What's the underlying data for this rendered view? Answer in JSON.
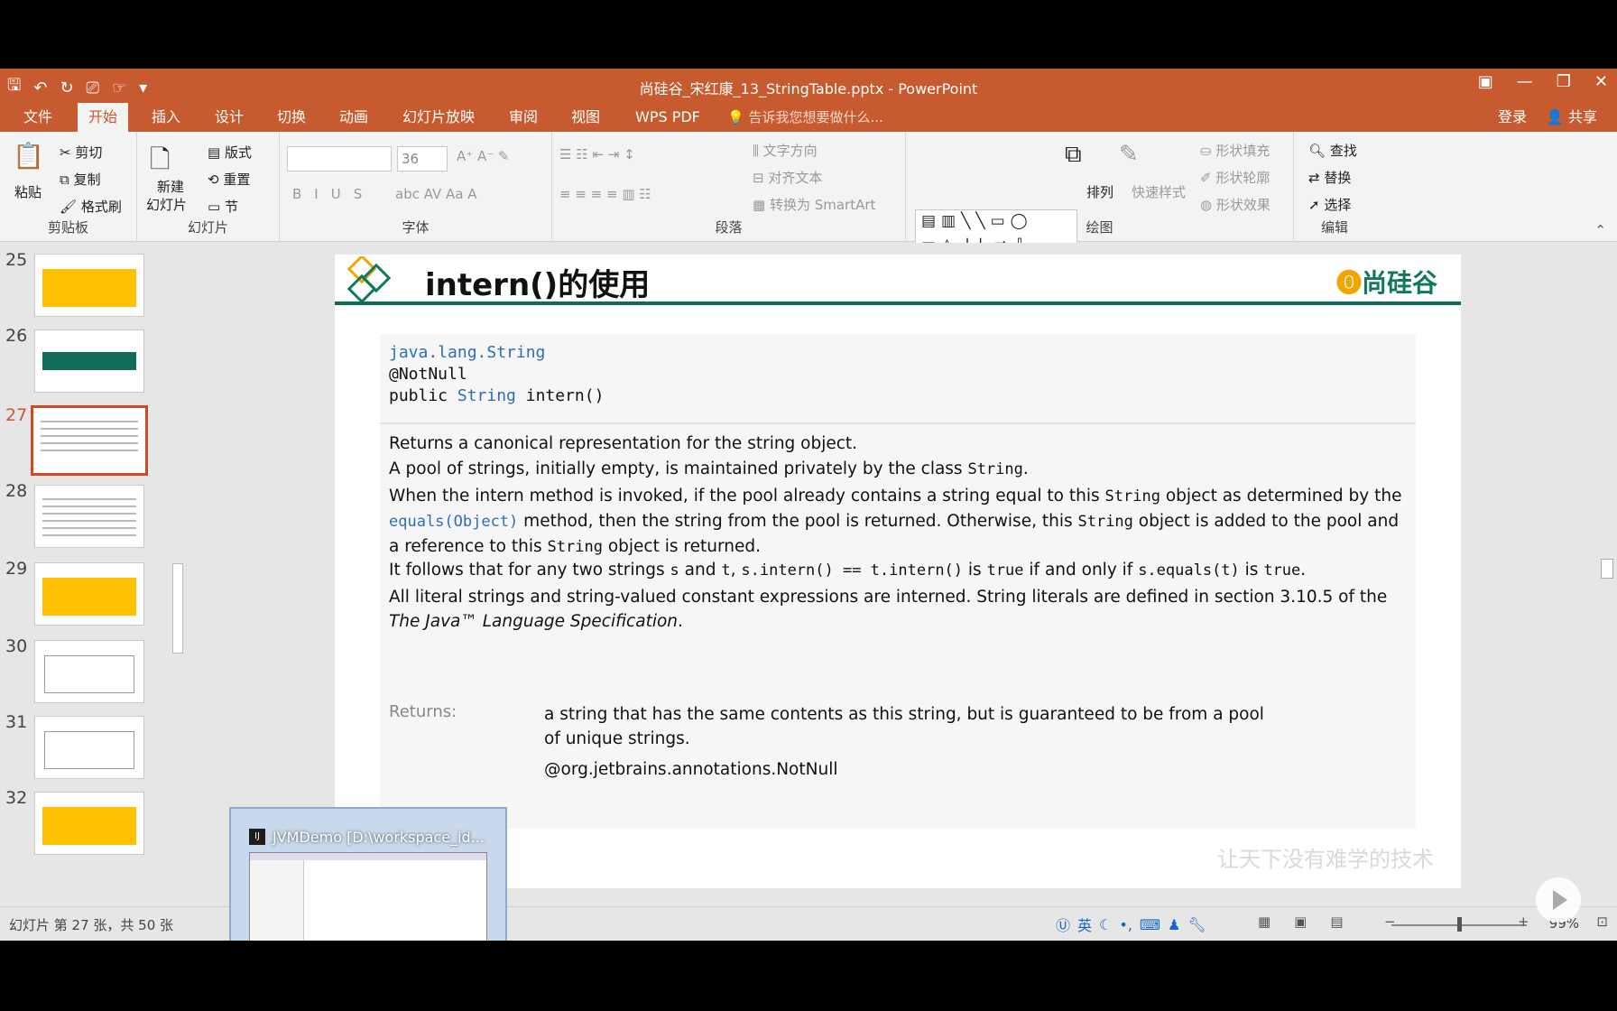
{
  "titlebar": {
    "doc_title": "尚硅谷_宋红康_13_StringTable.pptx - PowerPoint"
  },
  "tabs": [
    {
      "label": "文件"
    },
    {
      "label": "开始"
    },
    {
      "label": "插入"
    },
    {
      "label": "设计"
    },
    {
      "label": "切换"
    },
    {
      "label": "动画"
    },
    {
      "label": "幻灯片放映"
    },
    {
      "label": "审阅"
    },
    {
      "label": "视图"
    },
    {
      "label": "WPS PDF"
    }
  ],
  "tellme": "告诉我您想要做什么...",
  "login": "登录",
  "share": "共享",
  "ribbon": {
    "clipboard": {
      "paste": "粘贴",
      "cut": "剪切",
      "copy": "复制",
      "format_painter": "格式刷",
      "label": "剪贴板"
    },
    "slides": {
      "new_slide": "新建",
      "new_slide2": "幻灯片",
      "layout": "版式",
      "reset": "重置",
      "section": "节",
      "label": "幻灯片"
    },
    "font": {
      "font_name": "",
      "font_size": "36",
      "label": "字体"
    },
    "paragraph": {
      "text_direction": "文字方向",
      "align_text": "对齐文本",
      "smartart": "转换为 SmartArt",
      "label": "段落"
    },
    "drawing": {
      "arrange": "排列",
      "quick_styles": "快速样式",
      "shape_fill": "形状填充",
      "shape_outline": "形状轮廓",
      "shape_effects": "形状效果",
      "label": "绘图"
    },
    "editing": {
      "find": "查找",
      "replace": "替换",
      "select": "选择",
      "label": "编辑"
    }
  },
  "thumbnails": [
    {
      "num": "25",
      "kind": "yellow"
    },
    {
      "num": "26",
      "kind": "green"
    },
    {
      "num": "27",
      "kind": "text"
    },
    {
      "num": "28",
      "kind": "text"
    },
    {
      "num": "29",
      "kind": "yellow"
    },
    {
      "num": "30",
      "kind": "diagram"
    },
    {
      "num": "31",
      "kind": "diagram"
    },
    {
      "num": "32",
      "kind": "yellow"
    }
  ],
  "selected_slide": "27",
  "slide": {
    "title": "intern()的使用",
    "logo": "尚硅谷",
    "watermark": "让天下没有难学的技术",
    "code_line1": "java.lang.String",
    "code_line2": "@NotNull",
    "code_line3_a": "public ",
    "code_line3_b": "String",
    "code_line3_c": " intern()",
    "p1": "Returns a canonical representation for the string object.",
    "p2a": "A pool of strings, initially empty, is maintained privately by the class ",
    "p2b": "String",
    "p2c": ".",
    "p3a": "When the intern method is invoked, if the pool already contains a string equal to this ",
    "p3b": "String",
    "p3c": " object as determined by the ",
    "p3d": "equals(Object)",
    "p3e": " method, then the string from the pool is returned. Otherwise, this ",
    "p3f": "String",
    "p3g": " object is added to the pool and a reference to this ",
    "p3h": "String",
    "p3i": " object is returned.",
    "p4a": "It follows that for any two strings ",
    "p4b": "s",
    "p4c": " and ",
    "p4d": "t",
    "p4e": ", ",
    "p4f": "s.intern() == t.intern()",
    "p4g": " is ",
    "p4h": "true",
    "p4i": " if and only if ",
    "p4j": "s.equals(t)",
    "p4k": " is ",
    "p4l": "true",
    "p4m": ".",
    "p5a": "All literal strings and string-valued constant expressions are interned. String literals are defined in section 3.10.5 of the ",
    "p5b": "The Java™ Language Specification",
    "p5c": ".",
    "returns_label": "Returns:",
    "returns_text": "a string that has the same contents as this string, but is guaranteed to be from a pool of unique strings.",
    "notnull2": "@org.jetbrains.annotations.NotNull"
  },
  "popup": {
    "title": "JVMDemo [D:\\workspace_id..."
  },
  "statusbar": {
    "slide_info": "幻灯片 第 27 张，共 50 张",
    "ime": "英",
    "zoom": "99%"
  },
  "colors": {
    "brand": "#c75a2e",
    "slide_rule": "#0f6b5a",
    "link": "#2f6eb5",
    "selected_thumb": "#d24726"
  }
}
